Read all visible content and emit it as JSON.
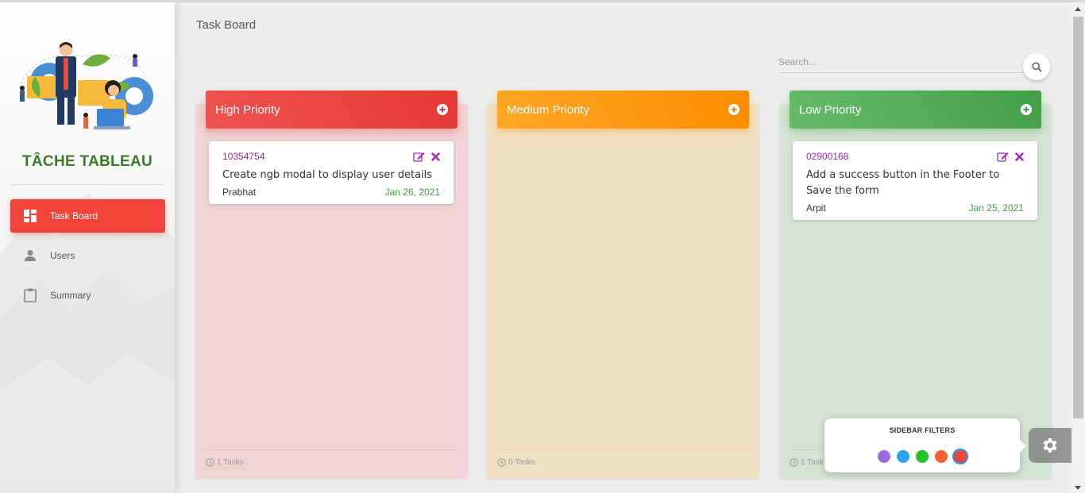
{
  "app": {
    "brand": "TÂCHE TABLEAU"
  },
  "sidebar": {
    "items": [
      {
        "label": "Task Board",
        "icon": "dashboard-icon",
        "active": true
      },
      {
        "label": "Users",
        "icon": "person-icon",
        "active": false
      },
      {
        "label": "Summary",
        "icon": "clipboard-icon",
        "active": false
      }
    ]
  },
  "header": {
    "title": "Task Board"
  },
  "search": {
    "placeholder": "Search...",
    "value": ""
  },
  "columns": [
    {
      "title": "High Priority",
      "color": "#e53935",
      "footer": "1 Tasks",
      "cards": [
        {
          "id": "10354754",
          "description": "Create ngb modal to display user details",
          "assignee": "Prabhat",
          "date": "Jan 26, 2021"
        }
      ]
    },
    {
      "title": "Medium Priority",
      "color": "#fb8c00",
      "footer": "0 Tasks",
      "cards": []
    },
    {
      "title": "Low Priority",
      "color": "#43a047",
      "footer": "1 Tasks",
      "cards": [
        {
          "id": "02900168",
          "description": "Add a success button in the Footer to Save the form",
          "assignee": "Arpit",
          "date": "Jan 25, 2021"
        }
      ]
    }
  ],
  "filters": {
    "title": "SIDEBAR FILTERS",
    "colors": [
      "#9c6ade",
      "#26a3f2",
      "#23c12a",
      "#f46233",
      "#f2433a"
    ],
    "selected_index": 4
  },
  "theme": {
    "accent": "#f2433a",
    "brand_color": "#3a7a2a",
    "task_id_color": "#9c27b0",
    "date_color": "#43a047"
  }
}
